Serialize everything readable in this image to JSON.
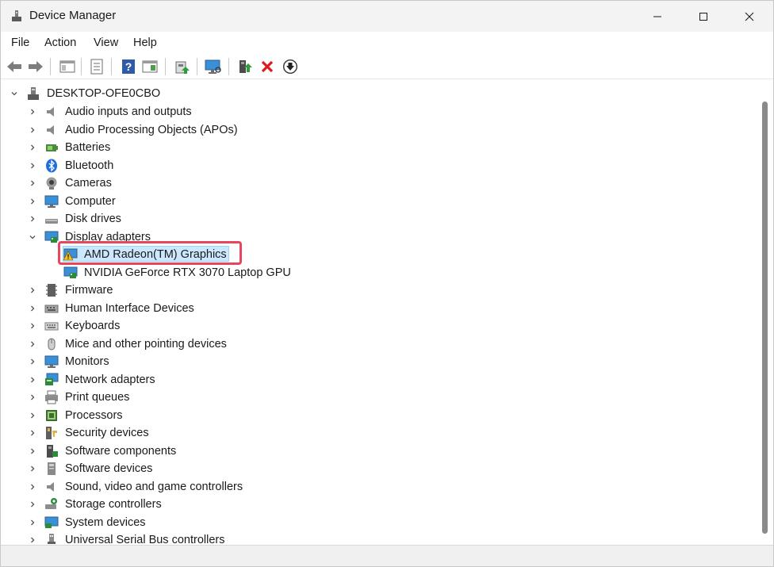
{
  "window": {
    "title": "Device Manager"
  },
  "menu": [
    "File",
    "Action",
    "View",
    "Help"
  ],
  "tree": {
    "root": "DESKTOP-OFE0CBO",
    "categories": [
      "Audio inputs and outputs",
      "Audio Processing Objects (APOs)",
      "Batteries",
      "Bluetooth",
      "Cameras",
      "Computer",
      "Disk drives",
      "Display adapters",
      "Firmware",
      "Human Interface Devices",
      "Keyboards",
      "Mice and other pointing devices",
      "Monitors",
      "Network adapters",
      "Print queues",
      "Processors",
      "Security devices",
      "Software components",
      "Software devices",
      "Sound, video and game controllers",
      "Storage controllers",
      "System devices",
      "Universal Serial Bus controllers"
    ],
    "display_children": [
      "AMD Radeon(TM) Graphics",
      "NVIDIA GeForce RTX 3070 Laptop GPU"
    ]
  },
  "colors": {
    "highlight_border": "#e8455e",
    "selection_fill": "#cce8ff",
    "error_x": "#e0191b"
  }
}
